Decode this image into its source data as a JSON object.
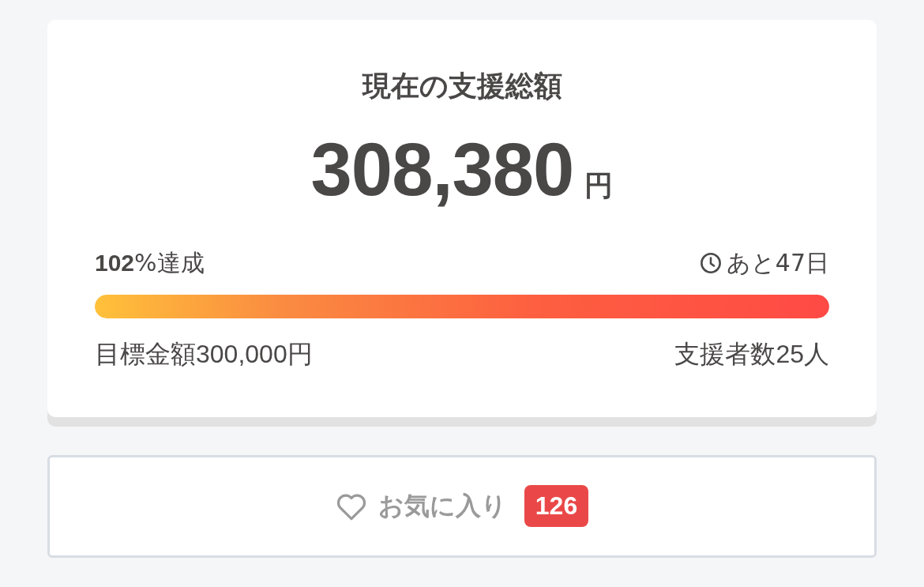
{
  "funding": {
    "title": "現在の支援総額",
    "amount": "308,380",
    "currency": "円",
    "achievement": "**102**%達成",
    "remaining": "あと47日",
    "level": 1,
    "goal": "目標金額300,000円",
    "backers": "支援者数25人"
  },
  "favorite": {
    "label": "お気に入り",
    "count": "126"
  }
}
